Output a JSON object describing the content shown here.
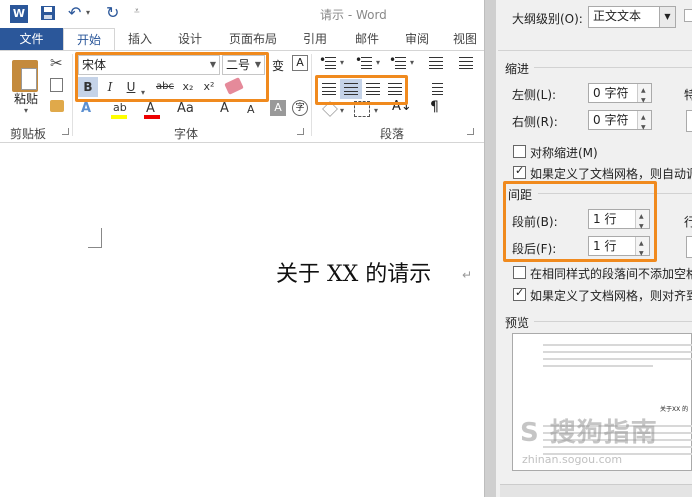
{
  "titlebar": {
    "logo": "W",
    "title": "请示 - Word"
  },
  "tabs": [
    {
      "label": "文件"
    },
    {
      "label": "开始"
    },
    {
      "label": "插入"
    },
    {
      "label": "设计"
    },
    {
      "label": "页面布局"
    },
    {
      "label": "引用"
    },
    {
      "label": "邮件"
    },
    {
      "label": "审阅"
    },
    {
      "label": "视图"
    }
  ],
  "ribbon": {
    "clipboard": {
      "paste_label": "粘贴",
      "group_label": "剪贴板"
    },
    "font": {
      "font_name": "宋体",
      "font_size": "二号",
      "bold": "B",
      "italic": "I",
      "underline": "U",
      "strike": "abc",
      "subscript": "x₂",
      "superscript": "x²",
      "text_effect": "A",
      "highlight": "ab",
      "font_color": "A",
      "change_case": "Aa",
      "grow": "A",
      "shrink": "A",
      "char_shading": "A",
      "enclose": "字",
      "phonetic": "变",
      "char_border": "A",
      "group_label": "字体"
    },
    "paragraph": {
      "sort": "A↓",
      "show_marks": "¶",
      "group_label": "段落"
    }
  },
  "document": {
    "text": "关于 XX 的请示",
    "para_mark": "↵"
  },
  "dialog": {
    "outline_label": "大纲级别(O):",
    "outline_value": "正文文本",
    "indent_section": "缩进",
    "left_label": "左侧(L):",
    "left_value": "0 字符",
    "right_label": "右侧(R):",
    "right_value": "0 字符",
    "mirror_label": "对称缩进(M)",
    "mirror_checked": false,
    "grid_indent_label": "如果定义了文档网格，则自动调",
    "grid_indent_checked": true,
    "spacing_section": "间距",
    "before_label": "段前(B):",
    "before_value": "1 行",
    "after_label": "段后(F):",
    "after_value": "1 行",
    "right_col_label": "行",
    "no_space_label": "在相同样式的段落间不添加空格",
    "no_space_checked": false,
    "grid_align_label": "如果定义了文档网格，则对齐到",
    "grid_align_checked": true,
    "preview_section": "预览",
    "preview_title": "关于XX 的",
    "watermark": "S 搜狗指南",
    "watermark_url": "zhinan.sogou.com"
  },
  "colors": {
    "accent": "#2b579a",
    "highlight_box": "#f08a1e"
  }
}
